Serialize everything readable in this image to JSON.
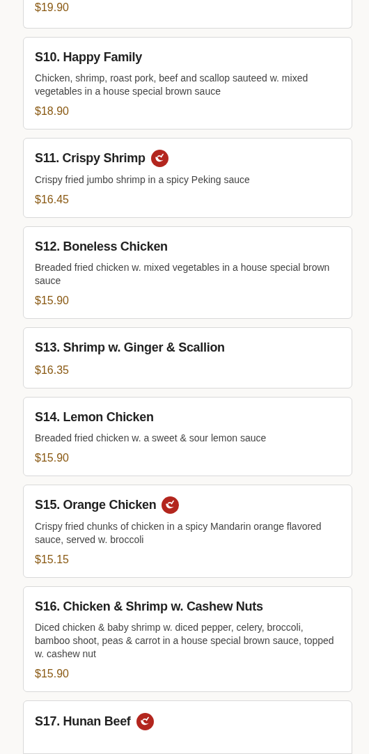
{
  "items": [
    {
      "price": "$19.90"
    },
    {
      "name": "S10. Happy Family",
      "spicy": false,
      "description": "Chicken, shrimp, roast pork, beef and scallop sauteed w. mixed vegetables in a house special brown sauce",
      "price": "$18.90"
    },
    {
      "name": "S11. Crispy Shrimp",
      "spicy": true,
      "description": "Crispy fried jumbo shrimp in a spicy Peking sauce",
      "price": "$16.45"
    },
    {
      "name": "S12. Boneless Chicken",
      "spicy": false,
      "description": "Breaded fried chicken w. mixed vegetables in a house special brown sauce",
      "price": "$15.90"
    },
    {
      "name": "S13. Shrimp w. Ginger & Scallion",
      "spicy": false,
      "price": "$16.35"
    },
    {
      "name": "S14. Lemon Chicken",
      "spicy": false,
      "description": "Breaded fried chicken w. a sweet & sour lemon sauce",
      "price": "$15.90"
    },
    {
      "name": "S15. Orange Chicken",
      "spicy": true,
      "description": "Crispy fried chunks of chicken in a spicy Mandarin orange flavored sauce, served w. broccoli",
      "price": "$15.15"
    },
    {
      "name": "S16. Chicken & Shrimp w. Cashew Nuts",
      "spicy": false,
      "description": "Diced chicken & baby shrimp w. diced pepper, celery, broccoli, bamboo shoot, peas & carrot in a house special brown sauce, topped w. cashew nut",
      "price": "$15.90"
    },
    {
      "name": "S17. Hunan Beef",
      "spicy": true
    }
  ]
}
